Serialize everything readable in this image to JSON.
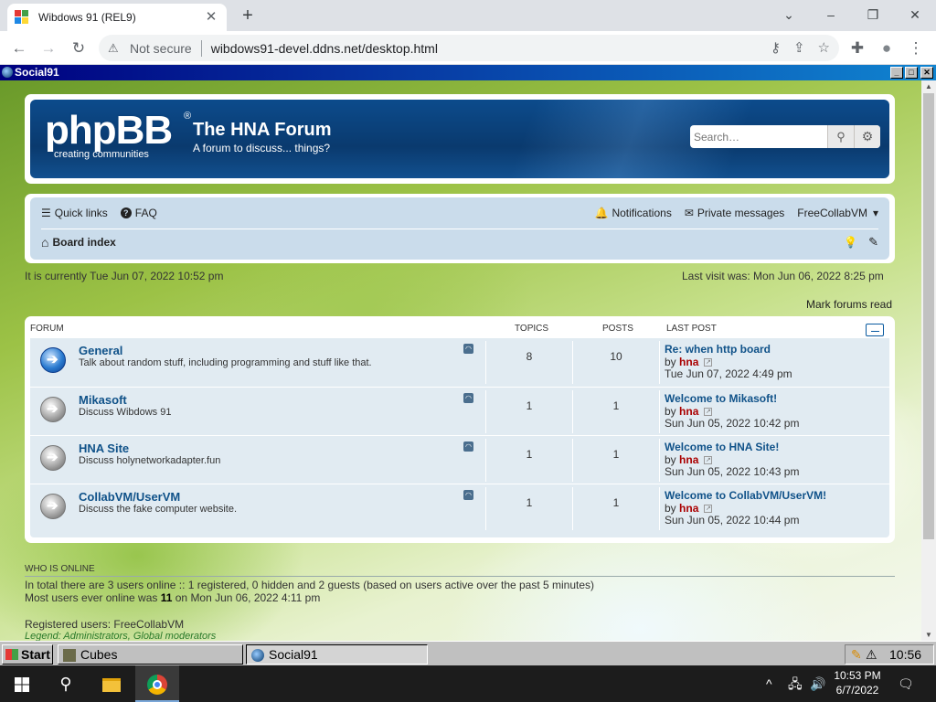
{
  "browser": {
    "tab_title": "Wibdows 91 (REL9)",
    "tab_close": "✕",
    "new_tab": "+",
    "not_secure": "Not secure",
    "url": "wibdows91-devel.ddns.net/desktop.html",
    "back_glyph": "←",
    "forward_glyph": "→",
    "reload_glyph": "↻",
    "warning_glyph": "⚠",
    "minimize_glyph": "–",
    "restore_glyph": "❐",
    "close_glyph": "✕",
    "chevron_glyph": "⌄",
    "key_glyph": "⚷",
    "share_glyph": "⇪",
    "star_glyph": "☆",
    "puzzle_glyph": "✚",
    "profile_glyph": "●",
    "menu_glyph": "⋮"
  },
  "vm_window": {
    "title": "Social91",
    "min_glyph": "_",
    "max_glyph": "□",
    "close_glyph": "✕"
  },
  "header": {
    "logo_text": "phpBB",
    "logo_reg": "®",
    "logo_sub": "creating  communities",
    "site_title": "The HNA Forum",
    "site_desc": "A forum to discuss... things?",
    "search_placeholder": "Search…",
    "search_glyph": "⚲",
    "advanced_glyph": "⚙"
  },
  "navbar": {
    "quick_links": "Quick links",
    "faq": "FAQ",
    "notifications": "Notifications",
    "private_messages": "Private messages",
    "username": "FreeCollabVM",
    "board_index": "Board index",
    "bars_glyph": "☰",
    "faq_glyph": "?",
    "bell_glyph": "🔔",
    "inbox_glyph": "✉",
    "caret_glyph": "▾",
    "home_glyph": "⌂",
    "bulb_glyph": "💡",
    "brush_glyph": "✎"
  },
  "times": {
    "current": "It is currently Tue Jun 07, 2022 10:52 pm",
    "last_visit": "Last visit was: Mon Jun 06, 2022 8:25 pm",
    "mark_read": "Mark forums read"
  },
  "forum_table": {
    "col_forum": "FORUM",
    "col_topics": "TOPICS",
    "col_posts": "POSTS",
    "col_last_post": "LAST POST",
    "by": "by",
    "rows": [
      {
        "name": "General",
        "desc": "Talk about random stuff, including programming and stuff like that.",
        "topics": "8",
        "posts": "10",
        "lp_title": "Re: when http board",
        "lp_user": "hna",
        "lp_date": "Tue Jun 07, 2022 4:49 pm",
        "unread": true
      },
      {
        "name": "Mikasoft",
        "desc": "Discuss Wibdows 91",
        "topics": "1",
        "posts": "1",
        "lp_title": "Welcome to Mikasoft!",
        "lp_user": "hna",
        "lp_date": "Sun Jun 05, 2022 10:42 pm",
        "unread": false
      },
      {
        "name": "HNA Site",
        "desc": "Discuss holynetworkadapter.fun",
        "topics": "1",
        "posts": "1",
        "lp_title": "Welcome to HNA Site!",
        "lp_user": "hna",
        "lp_date": "Sun Jun 05, 2022 10:43 pm",
        "unread": false
      },
      {
        "name": "CollabVM/UserVM",
        "desc": "Discuss the fake computer website.",
        "topics": "1",
        "posts": "1",
        "lp_title": "Welcome to CollabVM/UserVM!",
        "lp_user": "hna",
        "lp_date": "Sun Jun 05, 2022 10:44 pm",
        "unread": false
      }
    ]
  },
  "online": {
    "title": "WHO IS ONLINE",
    "line1": "In total there are 3 users online :: 1 registered, 0 hidden and 2 guests (based on users active over the past 5 minutes)",
    "line2_pre": "Most users ever online was ",
    "line2_num": "11",
    "line2_post": " on Mon Jun 06, 2022 4:11 pm",
    "line3": "Registered users: FreeCollabVM",
    "line4": "Legend: Administrators, Global moderators"
  },
  "vm_taskbar": {
    "start": "Start",
    "cubes": "Cubes",
    "social": "Social91",
    "clock": "10:56",
    "tray_glyph": "⚠"
  },
  "win10_taskbar": {
    "time": "10:53 PM",
    "date": "6/7/2022",
    "search_glyph": "⚲",
    "chevron_glyph": "^",
    "network_glyph": "🖧",
    "volume_glyph": "🔊",
    "notify_glyph": "🗨"
  },
  "colors": {
    "link": "#105289",
    "user_red": "#aa0000",
    "banner": "#0c4b8c",
    "navbar_bg": "#cadceb",
    "rows_bg": "#e1ebf2"
  }
}
